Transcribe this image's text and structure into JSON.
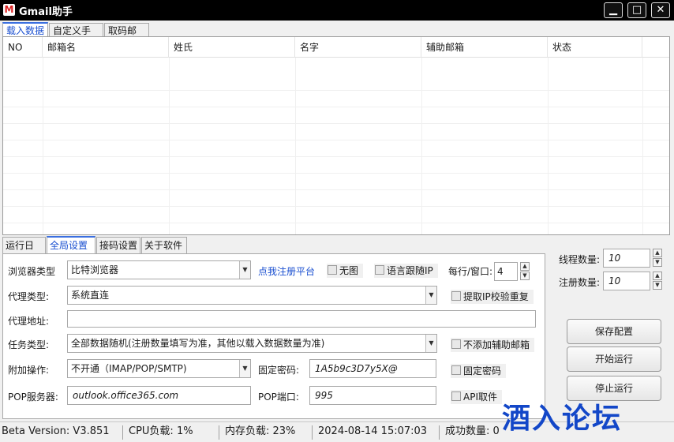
{
  "window": {
    "title": "Gmail助手",
    "icon_letter": "M",
    "minimize": "▁",
    "maximize": "□",
    "close": "✕"
  },
  "top_tabs": [
    "载入数据",
    "自定义手机",
    "取码邮箱"
  ],
  "table": {
    "columns": [
      "NO",
      "邮箱名",
      "姓氏",
      "名字",
      "辅助邮箱",
      "状态"
    ]
  },
  "bottom_tabs": [
    "运行日志",
    "全局设置",
    "接码设置",
    "关于软件"
  ],
  "settings": {
    "browser_type_label": "浏览器类型",
    "browser_type_value": "比特浏览器",
    "register_link": "点我注册平台",
    "no_image_label": "无图",
    "lang_follow_ip_label": "语言跟随IP",
    "per_row_window_label": "每行/窗口:",
    "per_row_window_value": "4",
    "proxy_type_label": "代理类型:",
    "proxy_type_value": "系统直连",
    "ip_check_repeat_label": "提取IP校验重复",
    "proxy_address_label": "代理地址:",
    "proxy_address_value": "",
    "task_type_label": "任务类型:",
    "task_type_value": "全部数据随机(注册数量填写为准，其他以载入数据数量为准)",
    "no_aux_email_label": "不添加辅助邮箱",
    "extra_op_label": "附加操作:",
    "extra_op_value": "不开通（IMAP/POP/SMTP)",
    "fixed_password_label": "固定密码:",
    "fixed_password_value": "1A5b9c3D7y5X@",
    "fixed_password_chk_label": "固定密码",
    "pop_server_label": "POP服务器:",
    "pop_server_value": "outlook.office365.com",
    "pop_port_label": "POP端口:",
    "pop_port_value": "995",
    "api_fetch_label": "API取件"
  },
  "side": {
    "thread_count_label": "线程数量:",
    "thread_count_value": "10",
    "register_count_label": "注册数量:",
    "register_count_value": "10",
    "save_config": "保存配置",
    "start_run": "开始运行",
    "stop_run": "停止运行"
  },
  "status": {
    "version": "Beta Version:  V3.851",
    "cpu": "CPU负载:  1%",
    "memory": "内存负载:  23%",
    "datetime": "2024-08-14 15:07:03",
    "success": "成功数量:  0"
  },
  "watermark": "酒入论坛"
}
